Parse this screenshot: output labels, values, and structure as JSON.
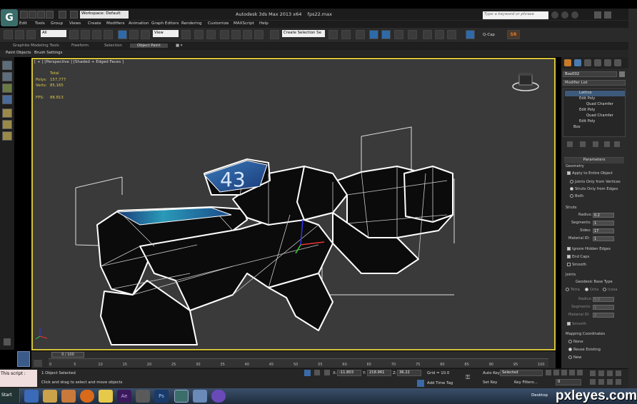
{
  "app": {
    "title": "Autodesk 3ds Max 2013 x64",
    "filename": "fps22.max",
    "logo_letter": "G",
    "workspace": "Workspace: Default",
    "search_placeholder": "Type a keyword or phrase"
  },
  "menu": [
    "Edit",
    "Tools",
    "Group",
    "Views",
    "Create",
    "Modifiers",
    "Animation",
    "Graph Editors",
    "Rendering",
    "Customize",
    "MAXScript",
    "Help"
  ],
  "toolbar": {
    "selection_filter": "All",
    "reference_coord": "View",
    "named_selection": "Create Selection Se",
    "qcap_label": "Q-Cap",
    "sr_label": "SR"
  },
  "ribbon_tabs": [
    "Graphite Modeling Tools",
    "Freeform",
    "Selection",
    "Object Paint"
  ],
  "ribbon_active": "Object Paint",
  "ribbon_sub": [
    "Paint Objects",
    "Brush Settings"
  ],
  "viewport": {
    "label": "[ + ] [Perspective ] [Shaded + Edged Faces ]",
    "stats_header": "Total",
    "polys_label": "Polys:",
    "polys_value": "157,777",
    "verts_label": "Verts:",
    "verts_value": "85,165",
    "fps_label": "FPS:",
    "fps_value": "88.813",
    "screen_text": "43"
  },
  "command_panel": {
    "object_name": "Box002",
    "modifier_list": "Modifier List",
    "stack": [
      "Lattice",
      "Edit Poly",
      "Quad Chamfer",
      "Edit Poly",
      "Quad Chamfer",
      "Edit Poly",
      "Box"
    ],
    "stack_selected": 0,
    "parameters_title": "Parameters",
    "geometry_title": "Geometry",
    "geometry_options": [
      "Apply to Entire Object",
      "Joints Only from Vertices",
      "Struts Only from Edges",
      "Both"
    ],
    "struts_title": "Struts",
    "radius_label": "Radius:",
    "radius_value": "0.2",
    "segments_label": "Segments:",
    "segments_value": "1",
    "sides_label": "Sides:",
    "sides_value": "17",
    "material_id_label": "Material ID:",
    "material_id_value": "1",
    "ignore_hidden": "Ignore Hidden Edges",
    "end_caps": "End Caps",
    "smooth": "Smooth",
    "joints_title": "Joints",
    "geodesic_title": "Geodesic Base Type",
    "geodesic_options": [
      "Tetra",
      "Octa",
      "Icosa"
    ],
    "j_radius_value": "5.0",
    "j_segments_value": "1",
    "j_material_value": "2",
    "j_smooth": "Smooth",
    "mapping_title": "Mapping Coordinates",
    "mapping_options": [
      "None",
      "Reuse Existing",
      "New"
    ]
  },
  "timeline": {
    "slider": "0 / 100",
    "ticks": [
      "0",
      "5",
      "10",
      "15",
      "20",
      "25",
      "30",
      "35",
      "40",
      "45",
      "50",
      "55",
      "60",
      "65",
      "70",
      "75",
      "80",
      "85",
      "90",
      "95",
      "100"
    ]
  },
  "status": {
    "maxscript": "This script :",
    "selected": "1 Object Selected",
    "prompt": "Click and drag to select and move objects",
    "x_value": "-11.803",
    "y_value": "218.961",
    "z_value": "36.22",
    "grid": "Grid = 10.0",
    "add_time_tag": "Add Time Tag",
    "auto_key": "Auto Key",
    "selected_dd": "Selected",
    "set_key": "Set Key",
    "key_filters": "Key Filters...",
    "frame_value": "0",
    "x_label": "X:",
    "y_label": "Y:",
    "z_label": "Z:"
  },
  "taskbar": {
    "start": "Start",
    "desktop": "Desktop"
  },
  "watermark": "pxleyes.com",
  "colors": {
    "viewport_border": "#d4c23a",
    "stats": "#e0c84a",
    "accent": "#2f6aa8"
  }
}
